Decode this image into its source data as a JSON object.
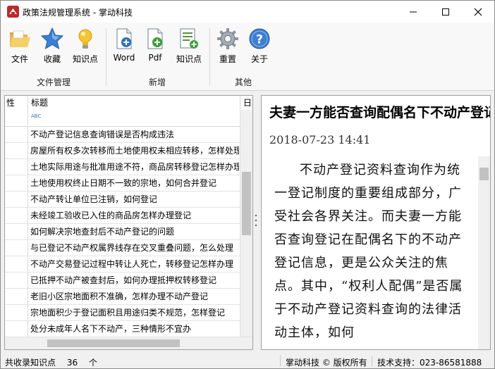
{
  "window": {
    "title": "政策法规管理系统 - 掌动科技"
  },
  "ribbon": {
    "groups": [
      {
        "label": "文件管理",
        "buttons": [
          {
            "label": "文件",
            "icon": "folder-open-icon"
          },
          {
            "label": "收藏",
            "icon": "star-icon"
          },
          {
            "label": "知识点",
            "icon": "lightbulb-icon"
          }
        ]
      },
      {
        "label": "新增",
        "buttons": [
          {
            "label": "Word",
            "icon": "word-add-icon"
          },
          {
            "label": "Pdf",
            "icon": "pdf-add-icon"
          },
          {
            "label": "知识点",
            "icon": "list-add-icon"
          }
        ]
      },
      {
        "label": "其他",
        "buttons": [
          {
            "label": "重置",
            "icon": "gear-icon"
          },
          {
            "label": "关于",
            "icon": "help-icon"
          }
        ]
      }
    ]
  },
  "grid": {
    "columns": [
      "性",
      "标题",
      "日期"
    ],
    "filter_placeholder": "ABC",
    "rows": [
      "不动产登记信息查询错误是否构成违法",
      "房屋所有权多次转移而土地使用权未相应转移，怎样处理",
      "土地实际用途与批准用途不符，商品房转移登记怎样办理",
      "土地使用权终止日期不一致的宗地，如何合并登记",
      "不动产转让单位已注销，如何登记",
      "未经竣工验收已入住的商品房怎样办理登记",
      "如何解决宗地查封后不动产登记的问题",
      "与已登记不动产权属界线存在交叉重叠问题，怎么处理",
      "不动产交易登记过程中转让人死亡，转移登记怎样办理",
      "已抵押不动产被查封后，如何办理抵押权转移登记",
      "老旧小区宗地面积不准确，怎样办理不动产登记",
      "宗地面积少于登记面积且用途归类不规范，怎样登记",
      "处分未成年人名下不动产，三种情形不宜办"
    ]
  },
  "article": {
    "title": "夫妻一方能否查询配偶名下不动产登记信息",
    "date": "2018-07-23 14:41",
    "body": "不动产登记资料查询作为统一登记制度的重要组成部分，广受社会各界关注。而夫妻一方能否查询登记在配偶名下的不动产登记信息，更是公众关注的焦点。其中，“权利人配偶”是否属于不动产登记资料查询的法律活动主体，如何"
  },
  "status": {
    "count_label": "共收录知识点",
    "count": "36",
    "count_unit": "个",
    "copyright": "掌动科技 © 版权所有",
    "support": "技术支持：023-86581888"
  },
  "colors": {
    "accent_blue": "#2f6fc2",
    "title_red": "#c0282a"
  }
}
